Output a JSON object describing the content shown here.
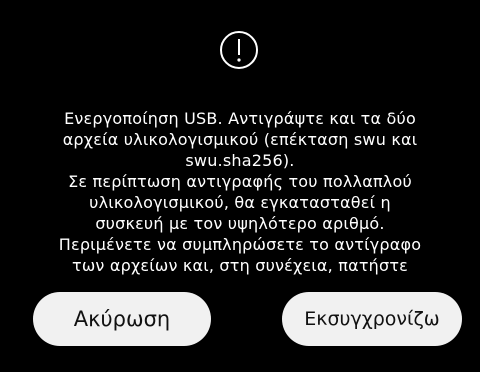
{
  "dialog": {
    "icon": "exclamation-circle-icon",
    "message_lines": [
      "Ενεργοποίηση USB. Αντιγράψτε και τα δύο",
      "αρχεία υλικολογισμικού (επέκταση swu και",
      "swu.sha256).",
      "Σε περίπτωση αντιγραφής του πολλαπλού",
      "υλικολογισμικού, θα εγκατασταθεί η",
      "συσκευή με τον υψηλότερο αριθμό.",
      "Περιμένετε να συμπληρώσετε το αντίγραφο",
      "των αρχείων και, στη συνέχεια, πατήστε"
    ],
    "cancel_label": "Ακύρωση",
    "update_label": "Εκσυγχρονίζω"
  },
  "colors": {
    "background": "#000000",
    "text": "#ffffff",
    "button_bg": "#f1f1f1",
    "button_text": "#111111"
  }
}
